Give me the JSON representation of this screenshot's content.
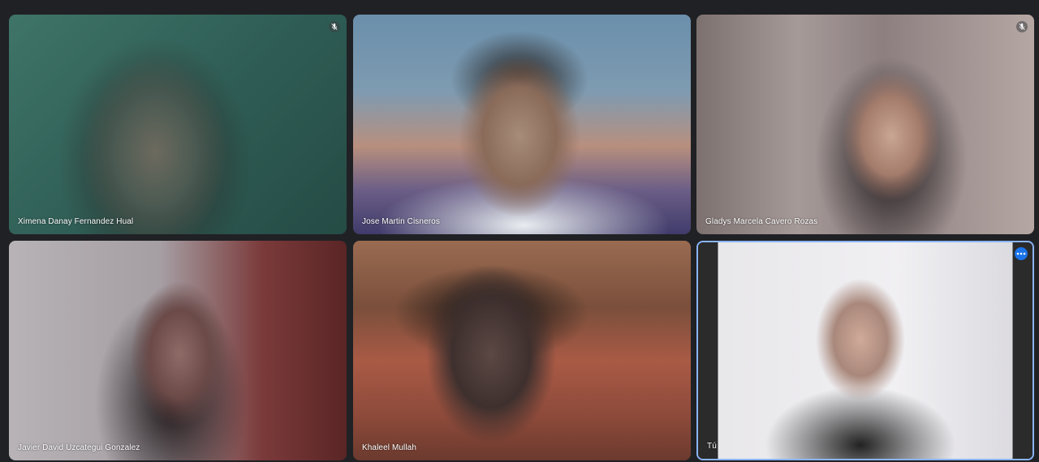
{
  "app": {
    "theme_background": "#202124",
    "selected_border_color": "#8ab4f8",
    "accent_color": "#1a73e8"
  },
  "participants": [
    {
      "name": "Ximena Danay Fernandez Hual",
      "muted": true,
      "mute_icon": "mic-off-icon"
    },
    {
      "name": "Jose Martin Cisneros",
      "muted": false
    },
    {
      "name": "Gladys Marcela Cavero Rozas",
      "muted": true,
      "mute_icon": "mic-off-icon"
    },
    {
      "name": "Javier David Uzcategui Gonzalez",
      "muted": false
    },
    {
      "name": "Khaleel Mullah",
      "muted": false
    },
    {
      "name": "Tú",
      "muted": false,
      "is_self": true,
      "options_icon": "more-options-icon"
    }
  ]
}
